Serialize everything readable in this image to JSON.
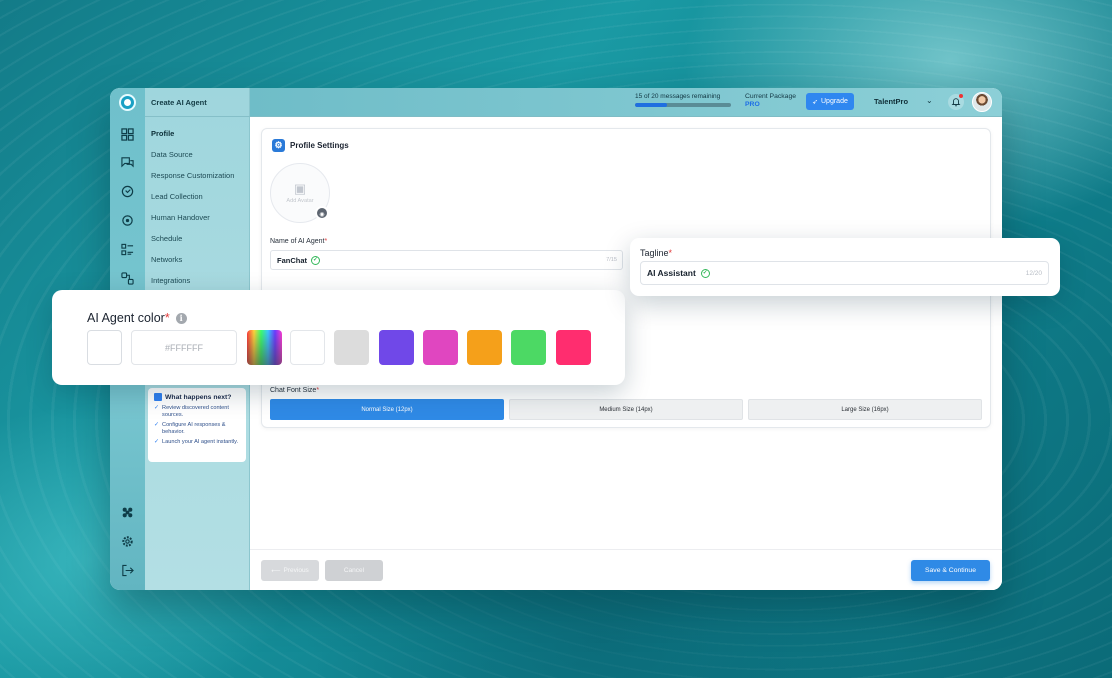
{
  "header": {
    "title": "Create AI Agent",
    "messages_text": "15 of 20 messages remaining",
    "messages_progress": 0.33,
    "package_label": "Current Package",
    "package_value": "PRO",
    "upgrade_label": "Upgrade",
    "workspace": "TalentPro"
  },
  "sidebar": {
    "items": [
      {
        "label": "Profile",
        "active": true
      },
      {
        "label": "Data Source"
      },
      {
        "label": "Response Customization"
      },
      {
        "label": "Lead Collection"
      },
      {
        "label": "Human Handover"
      },
      {
        "label": "Schedule"
      },
      {
        "label": "Networks"
      },
      {
        "label": "Integrations"
      }
    ],
    "next_card": {
      "title": "What happens next?",
      "steps": [
        "Review discovered content sources.",
        "Configure AI responses & behavior.",
        "Launch your AI agent instantly."
      ]
    }
  },
  "rail_icons": [
    "dashboard-icon",
    "chat-icon",
    "support-icon",
    "target-icon",
    "list-icon",
    "integrations-icon",
    "apps-icon",
    "settings-icon",
    "logout-icon"
  ],
  "profile": {
    "section_title": "Profile Settings",
    "avatar_label": "Add Avatar",
    "name_label": "Name of AI Agent",
    "name_value": "FanChat",
    "name_counter": "7/15",
    "font_size_label": "Chat Font Size",
    "font_sizes": [
      {
        "label": "Normal Size (12px)",
        "active": true
      },
      {
        "label": "Medium Size (14px)",
        "active": false
      },
      {
        "label": "Large Size (16px)",
        "active": false
      }
    ]
  },
  "tagline": {
    "label": "Tagline",
    "value": "AI Assistant",
    "counter": "12/20"
  },
  "agent_color": {
    "label": "AI Agent color",
    "hex_placeholder": "#FFFFFF",
    "current": "#FFFFFF",
    "swatches": [
      "rainbow",
      "#FFFFFF",
      "#DCDCDC",
      "#7048E8",
      "#E046C0",
      "#F5A01A",
      "#4CD964",
      "#FF2D6F"
    ]
  },
  "footer": {
    "previous_label": "Previous",
    "cancel_label": "Cancel",
    "save_label": "Save & Continue"
  }
}
